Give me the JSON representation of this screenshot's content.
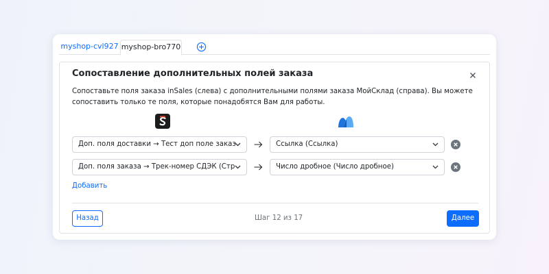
{
  "tabs": [
    {
      "label": "myshop-cvl927"
    },
    {
      "label": "myshop-bro770"
    }
  ],
  "modal": {
    "title": "Сопоставление дополнительных полей заказа",
    "description": "Сопоставьте поля заказа inSales (слева) с дополнительными полями заказа МойСклад (справа). Вы можете сопоставить только те поля, которые понадобятся Вам для работы."
  },
  "mappings": [
    {
      "left": "Доп. поля доставки → Тест доп поле заказа (Стр",
      "right": "Ссылка (Ссылка)"
    },
    {
      "left": "Доп. поля заказа → Трек-номер СДЭК (Строка)",
      "right": "Число дробное (Число дробное)"
    }
  ],
  "add_label": "Добавить",
  "footer": {
    "back_label": "Назад",
    "step_text": "Шаг 12 из 17",
    "next_label": "Далее"
  },
  "colors": {
    "accent": "#0d6efd",
    "moysklad_blue": "#1f74d9",
    "remove_icon": "#6c757d"
  }
}
